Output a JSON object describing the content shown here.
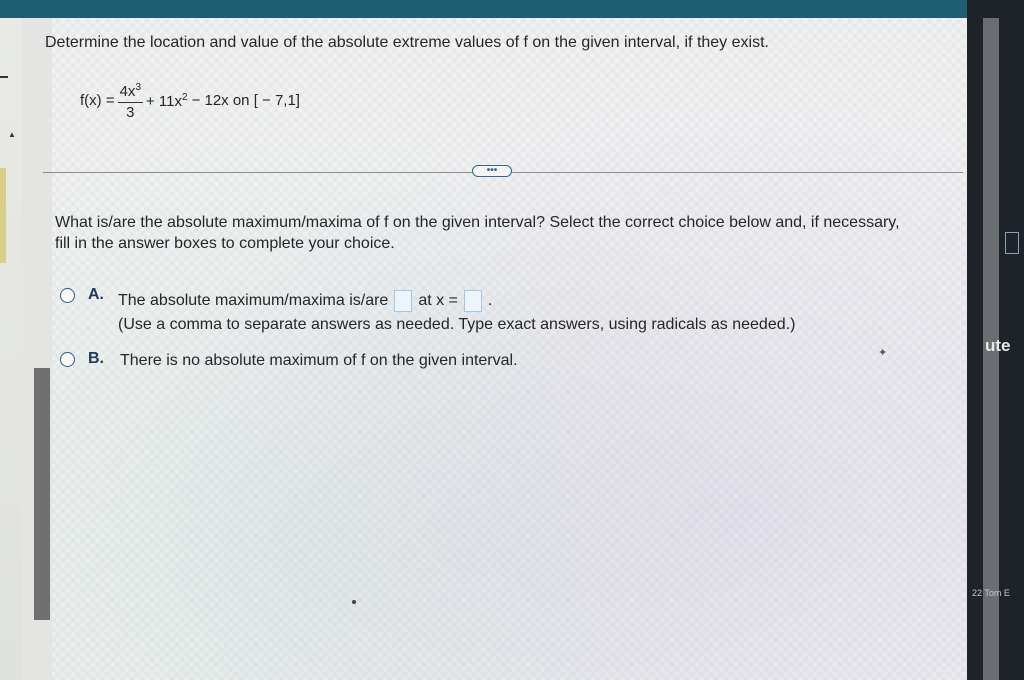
{
  "problem": {
    "instruction": "Determine the location and value of the absolute extreme values of f on the given interval, if they exist.",
    "formula": {
      "lhs": "f(x) =",
      "numerator": "4x",
      "numerator_exp": "3",
      "denominator": "3",
      "term2": "+ 11x",
      "term2_exp": "2",
      "rest": "− 12x on [ − 7,1]"
    }
  },
  "more_button": "•••",
  "question": "What is/are the absolute maximum/maxima of f on the given interval? Select the correct choice below and, if necessary, fill in the answer boxes to complete your choice.",
  "choices": {
    "a": {
      "letter": "A.",
      "text_before": "The absolute maximum/maxima is/are",
      "text_mid": "at x =",
      "text_end": ".",
      "note": "(Use a comma to separate answers as needed. Type exact answers, using radicals as needed.)"
    },
    "b": {
      "letter": "B.",
      "text": "There is no absolute maximum of f on the given interval."
    }
  },
  "side_panel": {
    "label": "ute",
    "small_text": "22 Tom E"
  },
  "colors": {
    "topbar": "#1d5e72",
    "accent": "#2d5d86",
    "answer_box_border": "#9fc7e6"
  }
}
